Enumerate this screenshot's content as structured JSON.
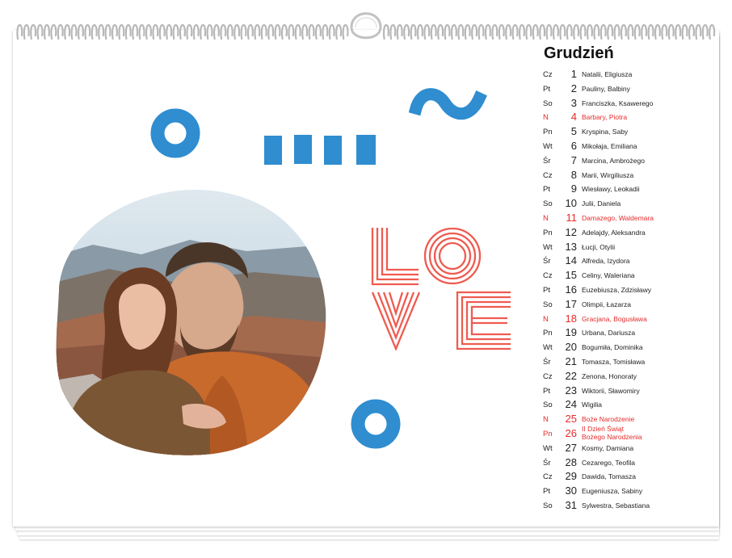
{
  "calendar": {
    "month_title": "Grudzień",
    "days": [
      {
        "wd": "Cz",
        "num": "1",
        "names": "Natalii, Eligiusza",
        "holiday": false
      },
      {
        "wd": "Pt",
        "num": "2",
        "names": "Pauliny, Balbiny",
        "holiday": false
      },
      {
        "wd": "So",
        "num": "3",
        "names": "Franciszka, Ksawerego",
        "holiday": false
      },
      {
        "wd": "N",
        "num": "4",
        "names": "Barbary, Piotra",
        "holiday": true
      },
      {
        "wd": "Pn",
        "num": "5",
        "names": "Kryspina, Saby",
        "holiday": false
      },
      {
        "wd": "Wt",
        "num": "6",
        "names": "Mikołaja, Emiliana",
        "holiday": false
      },
      {
        "wd": "Śr",
        "num": "7",
        "names": "Marcina, Ambrożego",
        "holiday": false
      },
      {
        "wd": "Cz",
        "num": "8",
        "names": "Marii, Wirgiliusza",
        "holiday": false
      },
      {
        "wd": "Pt",
        "num": "9",
        "names": "Wiesławy, Leokadii",
        "holiday": false
      },
      {
        "wd": "So",
        "num": "10",
        "names": "Julii, Daniela",
        "holiday": false
      },
      {
        "wd": "N",
        "num": "11",
        "names": "Damazego, Waldemara",
        "holiday": true
      },
      {
        "wd": "Pn",
        "num": "12",
        "names": "Adelajdy, Aleksandra",
        "holiday": false
      },
      {
        "wd": "Wt",
        "num": "13",
        "names": "Łucji, Otylii",
        "holiday": false
      },
      {
        "wd": "Śr",
        "num": "14",
        "names": "Alfreda, Izydora",
        "holiday": false
      },
      {
        "wd": "Cz",
        "num": "15",
        "names": "Celiny, Waleriana",
        "holiday": false
      },
      {
        "wd": "Pt",
        "num": "16",
        "names": "Euzebiusza, Zdzisławy",
        "holiday": false
      },
      {
        "wd": "So",
        "num": "17",
        "names": "Olimpii, Łazarza",
        "holiday": false
      },
      {
        "wd": "N",
        "num": "18",
        "names": "Gracjana, Bogusława",
        "holiday": true
      },
      {
        "wd": "Pn",
        "num": "19",
        "names": "Urbana, Dariusza",
        "holiday": false
      },
      {
        "wd": "Wt",
        "num": "20",
        "names": "Bogumiła, Dominika",
        "holiday": false
      },
      {
        "wd": "Śr",
        "num": "21",
        "names": "Tomasza, Tomisława",
        "holiday": false
      },
      {
        "wd": "Cz",
        "num": "22",
        "names": "Zenona, Honoraty",
        "holiday": false
      },
      {
        "wd": "Pt",
        "num": "23",
        "names": "Wiktorii, Sławomiry",
        "holiday": false
      },
      {
        "wd": "So",
        "num": "24",
        "names": "Wigilia",
        "holiday": false
      },
      {
        "wd": "N",
        "num": "25",
        "names": "Boże Narodzenie",
        "holiday": true
      },
      {
        "wd": "Pn",
        "num": "26",
        "names": "II Dzień Świąt\nBożego Narodzenia",
        "holiday": true
      },
      {
        "wd": "Wt",
        "num": "27",
        "names": "Kosmy, Damiana",
        "holiday": false
      },
      {
        "wd": "Śr",
        "num": "28",
        "names": "Cezarego, Teofila",
        "holiday": false
      },
      {
        "wd": "Cz",
        "num": "29",
        "names": "Dawida, Tomasza",
        "holiday": false
      },
      {
        "wd": "Pt",
        "num": "30",
        "names": "Eugeniusza, Sabiny",
        "holiday": false
      },
      {
        "wd": "So",
        "num": "31",
        "names": "Sylwestra, Sebastiana",
        "holiday": false
      }
    ]
  },
  "artwork": {
    "love_text_top": "LO",
    "love_text_bottom": "VE"
  },
  "colors": {
    "accent_blue": "#2f8dd0",
    "accent_red": "#ef5b50",
    "holiday_red": "#e52b2b"
  },
  "icons": {
    "binding": "spiral-binding",
    "hanger": "hanger-loop"
  }
}
